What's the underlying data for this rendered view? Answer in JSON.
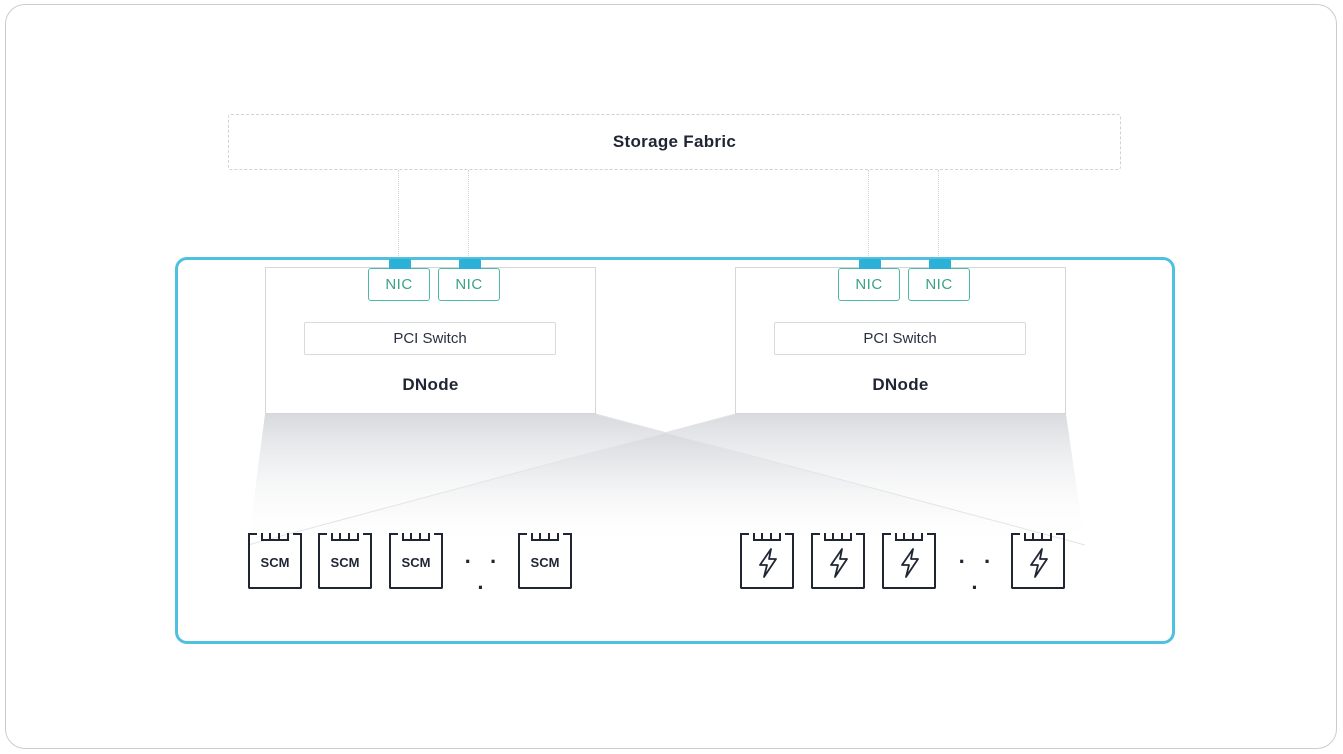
{
  "storage_fabric": {
    "label": "Storage Fabric"
  },
  "dnodes": [
    {
      "label": "DNode",
      "pci_label": "PCI Switch",
      "nics": [
        "NIC",
        "NIC"
      ]
    },
    {
      "label": "DNode",
      "pci_label": "PCI Switch",
      "nics": [
        "NIC",
        "NIC"
      ]
    }
  ],
  "scm_group": {
    "drive_label": "SCM",
    "ellipsis": "· · ·"
  },
  "flash_group": {
    "icon": "lightning-bolt-icon",
    "ellipsis": "· · ·"
  },
  "colors": {
    "enclosure": "#4fc0e0",
    "nic_border": "#4db9a4",
    "port": "#2bb0d8",
    "text": "#1f2533"
  }
}
